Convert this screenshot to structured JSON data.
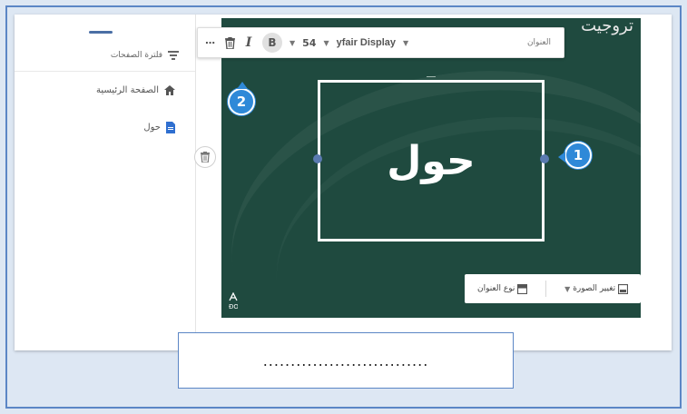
{
  "sidebar": {
    "filter_label": "فلترة الصفحات",
    "items": [
      {
        "label": "الصفحة الرئيسية",
        "icon": "home-icon"
      },
      {
        "label": "حول",
        "icon": "page-icon"
      }
    ]
  },
  "toolbar": {
    "more_label": "⋯",
    "italic_label": "I",
    "bold_label": "B",
    "font_size": "54",
    "font_name": "yfair Display",
    "heading_label": "العنوان"
  },
  "slide": {
    "top_title": "تروجيت",
    "title_text": "حول",
    "layout_bar": {
      "change_image_label": "تغيير الصورة",
      "title_type_label": "نوع العنوان"
    }
  },
  "callouts": {
    "one": "1",
    "two": "2"
  },
  "answer_placeholder": "..............................",
  "colors": {
    "slide_bg": "#1f4a3f",
    "badge": "#2f89d8",
    "frame_border": "#5b86c5"
  }
}
